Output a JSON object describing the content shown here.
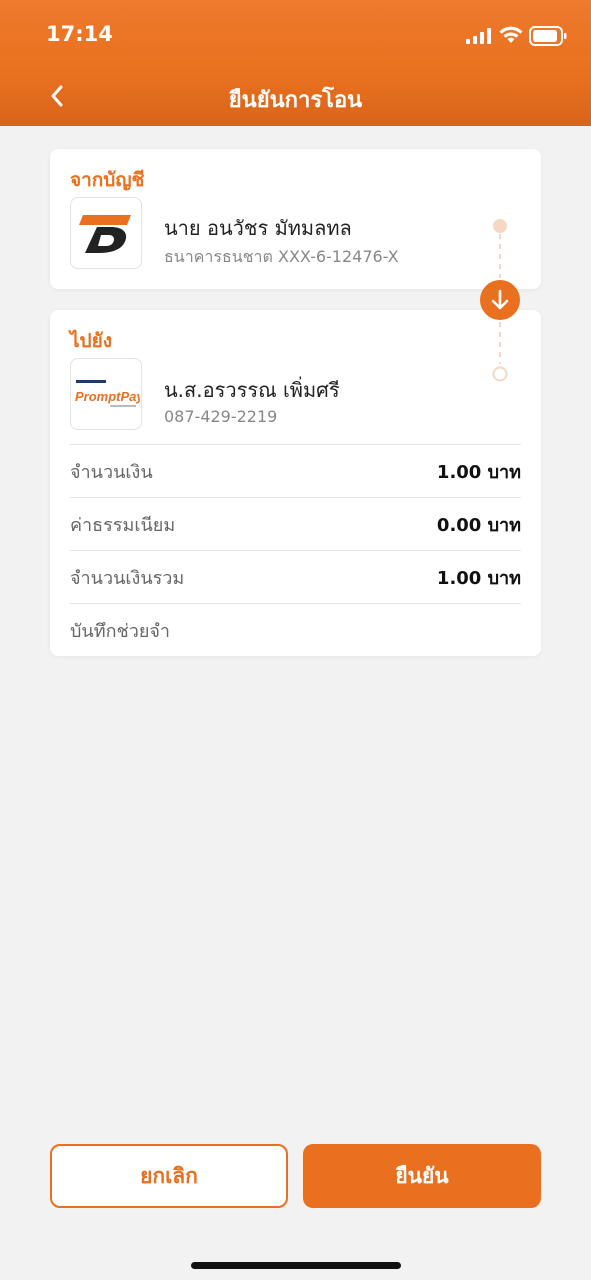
{
  "status_bar": {
    "time": "17:14"
  },
  "header": {
    "title": "ยืนยันการโอน"
  },
  "from": {
    "label": "จากบัญชี",
    "name": "นาย อนวัชร มัทมลทล",
    "account": "ธนาคารธนชาต XXX-6-12476-X"
  },
  "to": {
    "label": "ไปยัง",
    "name": "น.ส.อรวรรณ เพิ่มศรี",
    "account": "087-429-2219",
    "logo_text": "PromptPay"
  },
  "details": [
    {
      "label": "จำนวนเงิน",
      "value": "1.00 บาท"
    },
    {
      "label": "ค่าธรรมเนียม",
      "value": "0.00 บาท"
    },
    {
      "label": "จำนวนเงินรวม",
      "value": "1.00 บาท"
    },
    {
      "label": "บันทึกช่วยจำ",
      "value": ""
    }
  ],
  "buttons": {
    "cancel": "ยกเลิก",
    "confirm": "ยืนยัน"
  },
  "colors": {
    "accent": "#e8701f",
    "background": "#f2f2f2"
  }
}
